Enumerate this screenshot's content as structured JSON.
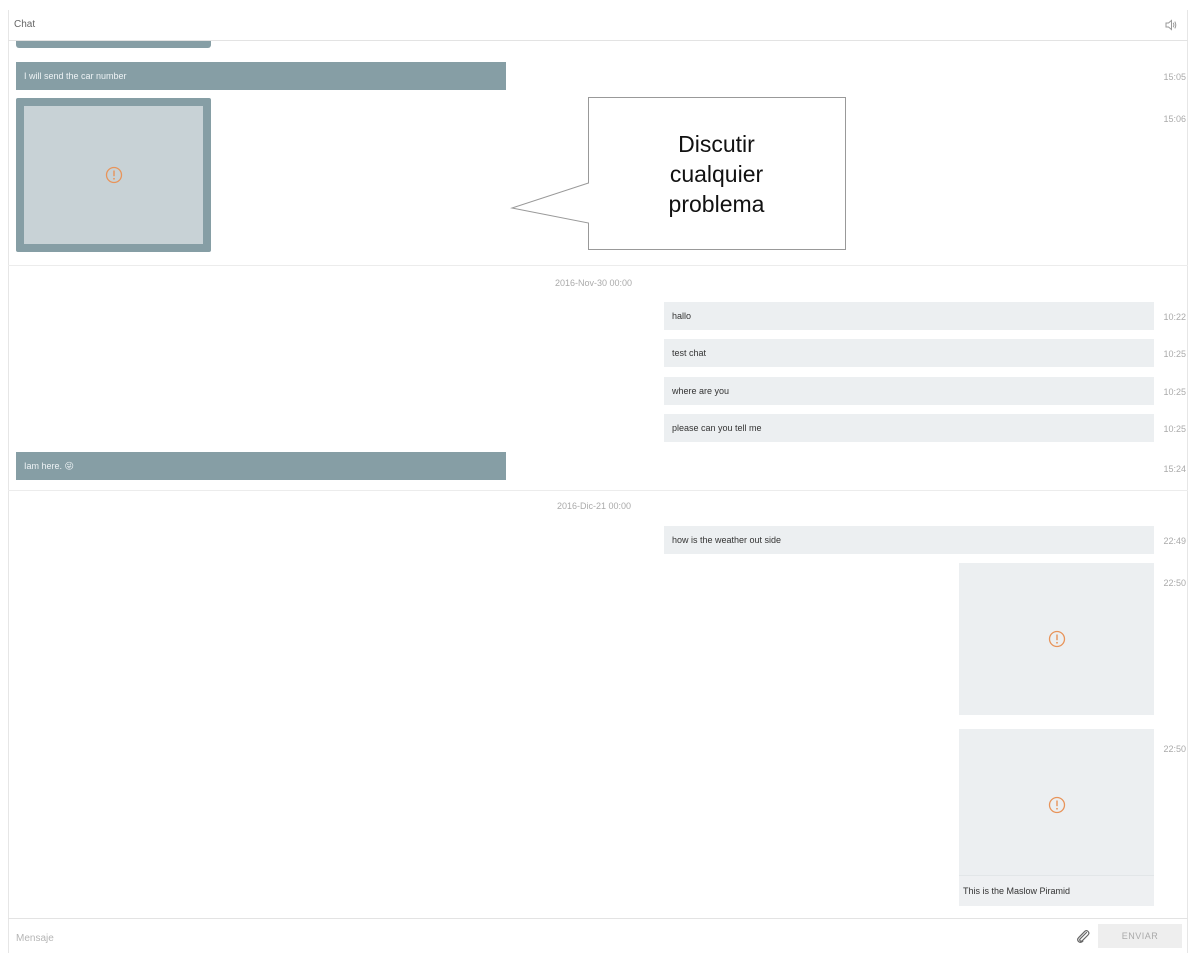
{
  "header": {
    "title": "Chat",
    "sound_icon": "speaker-icon"
  },
  "messages_day0": [
    {
      "text": "I will send the car number",
      "time": "15:05",
      "side": "out"
    },
    {
      "type": "image",
      "time": "15:06",
      "side": "out",
      "icon": "warning-circle-icon"
    }
  ],
  "day1": {
    "date": "2016-Nov-30 00:00",
    "messages": [
      {
        "text": "hallo",
        "time": "10:22",
        "side": "in"
      },
      {
        "text": "test chat",
        "time": "10:25",
        "side": "in"
      },
      {
        "text": "where are you",
        "time": "10:25",
        "side": "in"
      },
      {
        "text": "please can you tell me",
        "time": "10:25",
        "side": "in"
      },
      {
        "text": "Iam here. 😜",
        "time": "15:24",
        "side": "out"
      }
    ]
  },
  "day2": {
    "date": "2016-Dic-21 00:00",
    "messages": [
      {
        "text": "how is the weather out side",
        "time": "22:49",
        "side": "in"
      },
      {
        "type": "image",
        "time": "22:50",
        "side": "in",
        "icon": "warning-circle-icon"
      },
      {
        "type": "image",
        "time": "22:50",
        "side": "in",
        "icon": "warning-circle-icon",
        "caption": "This is the Maslow Piramid"
      }
    ]
  },
  "callout": {
    "lines": [
      "Discutir",
      "cualquier",
      "problema"
    ]
  },
  "footer": {
    "placeholder": "Mensaje",
    "attach_icon": "paperclip-icon",
    "send_label": "ENVIAR"
  },
  "colors": {
    "outgoing_bubble": "#869ea5",
    "incoming_bubble": "#eceff1",
    "warning": "#e8945a"
  }
}
